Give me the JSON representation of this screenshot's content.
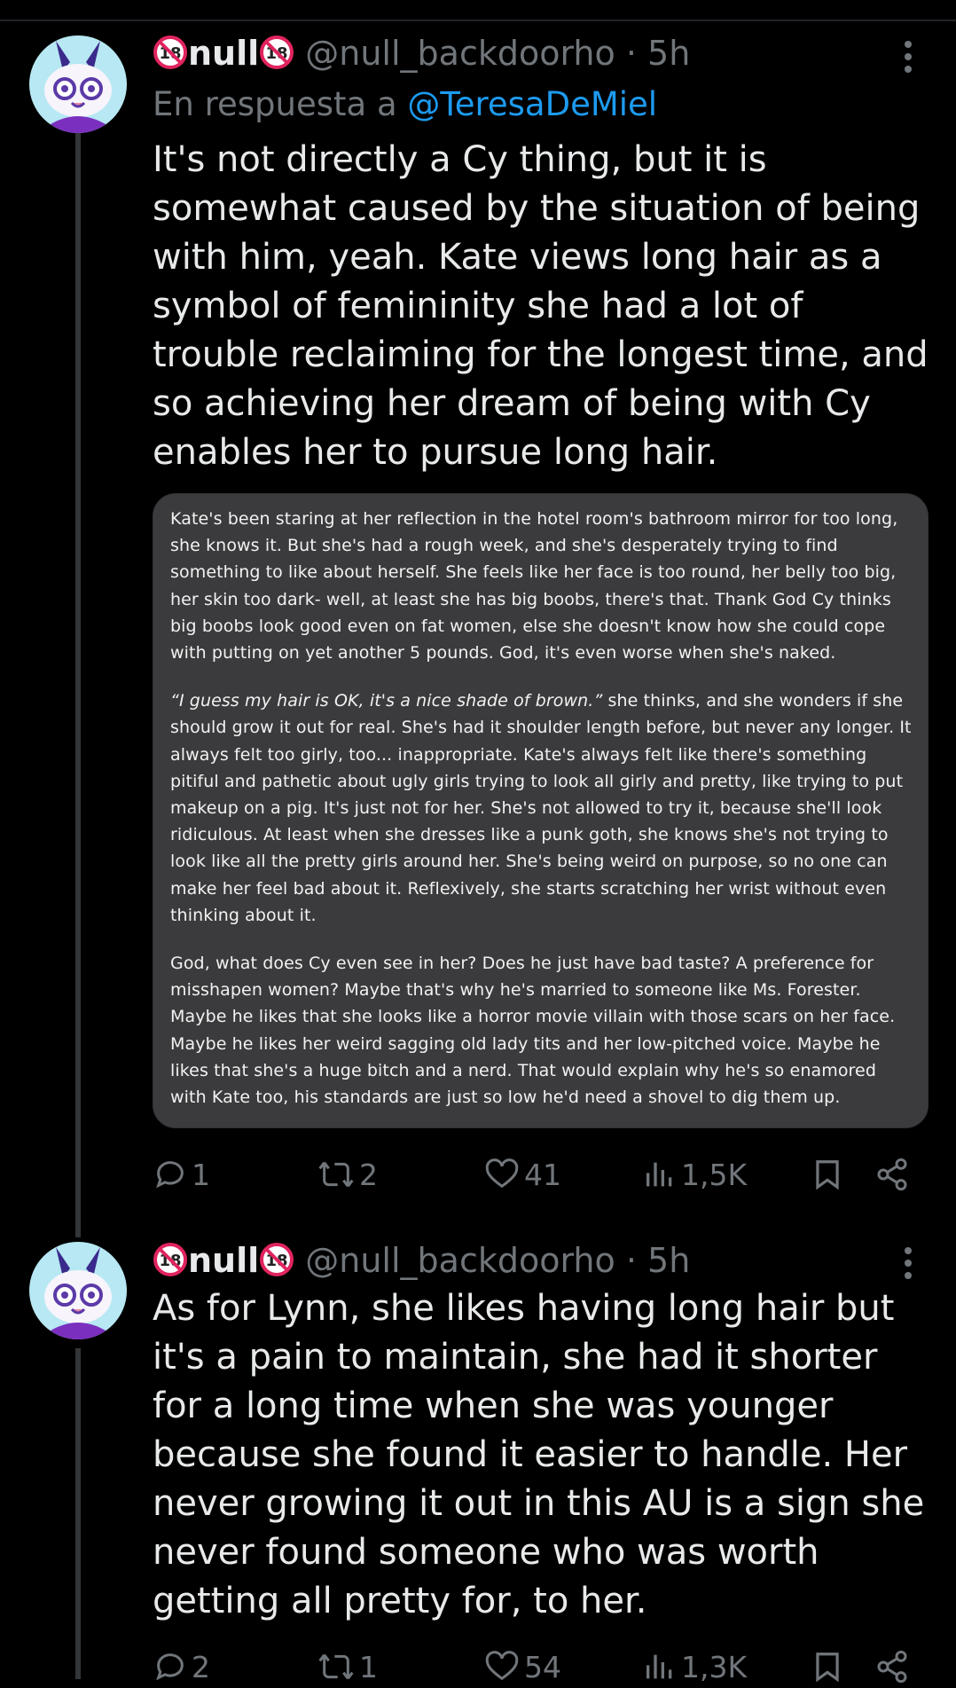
{
  "colors": {
    "background": "#000000",
    "text_primary": "#e7e9ea",
    "text_secondary": "#71767b",
    "link": "#1d9bf0",
    "thread_line": "#333639",
    "avatar_purple": "#7b2fbe",
    "avatar_bg": "#b7e8f3"
  },
  "posts": [
    {
      "display_name": "null",
      "badge_icon": "under-18-icon",
      "handle": "@null_backdoorho",
      "separator": "·",
      "time": "5h",
      "reply_prefix": "En respuesta a",
      "reply_mention": "@TeresaDeMiel",
      "text": "It's not directly a Cy thing, but it is somewhat caused by the situation of being with him, yeah. Kate views long hair as a symbol of femininity she had a lot of trouble reclaiming for the longest time, and so achieving her dream of being with Cy enables her to pursue long hair.",
      "attachment": {
        "paragraphs": [
          {
            "italic": "",
            "text": "Kate's been staring at her reflection in the hotel room's bathroom mirror for too long, she knows it. But she's had a rough week, and she's desperately trying to find something to like about herself. She feels like her face is too round, her belly too big, her skin too dark- well, at least she has big boobs, there's that. Thank God Cy thinks big boobs look good even on fat women, else she doesn't know how she could cope with putting on yet another 5 pounds. God, it's even worse when she's naked."
          },
          {
            "italic": "“I guess my hair is OK, it's a nice shade of brown.”",
            "text": " she thinks, and she wonders if she should grow it out for real. She's had it shoulder length before, but never any longer. It always felt too girly, too... inappropriate. Kate's always felt like there's something pitiful and pathetic about ugly girls trying to look all girly and pretty, like trying to put makeup on a pig. It's just not for her. She's not allowed to try it, because she'll look ridiculous. At least when she dresses like a punk goth, she knows she's not trying to look like all the pretty girls around her. She's being weird on purpose, so no one can make her feel bad about it. Reflexively, she starts scratching her wrist without even thinking about it."
          },
          {
            "italic": "",
            "text": "God, what does Cy even see in her? Does he just have bad taste? A preference for misshapen women? Maybe that's why he's married to someone like Ms. Forester. Maybe he likes that she looks like a horror movie villain with those scars on her face. Maybe he likes her weird sagging old lady tits and her low-pitched voice. Maybe he likes that she's a huge bitch and a nerd. That would explain why he's so enamored with Kate too, his standards are just so low he'd need a shovel to dig them up."
          }
        ]
      },
      "stats": {
        "replies": "1",
        "reposts": "2",
        "likes": "41",
        "views": "1,5K"
      }
    },
    {
      "display_name": "null",
      "badge_icon": "under-18-icon",
      "handle": "@null_backdoorho",
      "separator": "·",
      "time": "5h",
      "text": "As for Lynn, she likes having long hair but it's a pain to maintain, she had it shorter for a long time when she was younger because she found it easier to handle. Her never growing it out in this AU is a sign she never found someone who was worth getting all pretty for, to her.",
      "stats": {
        "replies": "2",
        "reposts": "1",
        "likes": "54",
        "views": "1,3K"
      }
    }
  ]
}
